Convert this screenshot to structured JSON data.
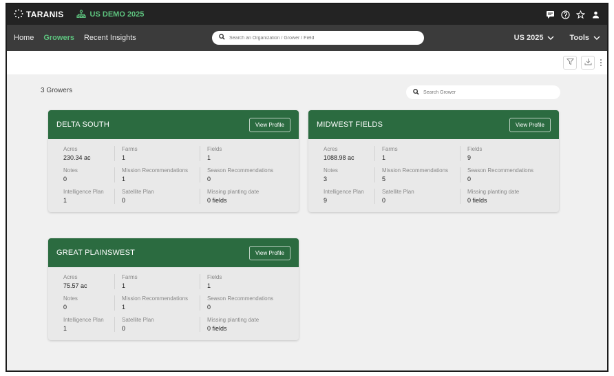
{
  "brand": {
    "name": "TARANIS",
    "org": "US DEMO 2025"
  },
  "nav": {
    "items": [
      {
        "label": "Home",
        "active": false
      },
      {
        "label": "Growers",
        "active": true
      },
      {
        "label": "Recent Insights",
        "active": false
      }
    ],
    "search_placeholder": "Search an Organization / Grower / Field",
    "season": "US 2025",
    "tools": "Tools"
  },
  "content": {
    "count": "3 Growers",
    "grower_search_placeholder": "Search Grower"
  },
  "colors": {
    "accent": "#5dc27e",
    "card_header": "#2b6b40",
    "topbar": "#232323",
    "navbar": "#3b3b3b"
  },
  "cards": [
    {
      "title": "DELTA SOUTH",
      "button": "View Profile",
      "stats": [
        {
          "label": "Acres",
          "value": "230.34 ac"
        },
        {
          "label": "Farms",
          "value": "1"
        },
        {
          "label": "Fields",
          "value": "1"
        },
        {
          "label": "Notes",
          "value": "0"
        },
        {
          "label": "Mission Recommendations",
          "value": "1"
        },
        {
          "label": "Season Recommendations",
          "value": "0"
        },
        {
          "label": "Intelligence Plan",
          "value": "1"
        },
        {
          "label": "Satellite Plan",
          "value": "0"
        },
        {
          "label": "Missing planting date",
          "value": "0 fields"
        }
      ]
    },
    {
      "title": "MIDWEST FIELDS",
      "button": "View Profile",
      "stats": [
        {
          "label": "Acres",
          "value": "1088.98 ac"
        },
        {
          "label": "Farms",
          "value": "1"
        },
        {
          "label": "Fields",
          "value": "9"
        },
        {
          "label": "Notes",
          "value": "3"
        },
        {
          "label": "Mission Recommendations",
          "value": "5"
        },
        {
          "label": "Season Recommendations",
          "value": "0"
        },
        {
          "label": "Intelligence Plan",
          "value": "9"
        },
        {
          "label": "Satellite Plan",
          "value": "0"
        },
        {
          "label": "Missing planting date",
          "value": "0 fields"
        }
      ]
    },
    {
      "title": "GREAT PLAINSWEST",
      "button": "View Profile",
      "stats": [
        {
          "label": "Acres",
          "value": "75.57 ac"
        },
        {
          "label": "Farms",
          "value": "1"
        },
        {
          "label": "Fields",
          "value": "1"
        },
        {
          "label": "Notes",
          "value": "0"
        },
        {
          "label": "Mission Recommendations",
          "value": "1"
        },
        {
          "label": "Season Recommendations",
          "value": "0"
        },
        {
          "label": "Intelligence Plan",
          "value": "1"
        },
        {
          "label": "Satellite Plan",
          "value": "0"
        },
        {
          "label": "Missing planting date",
          "value": "0 fields"
        }
      ]
    }
  ]
}
